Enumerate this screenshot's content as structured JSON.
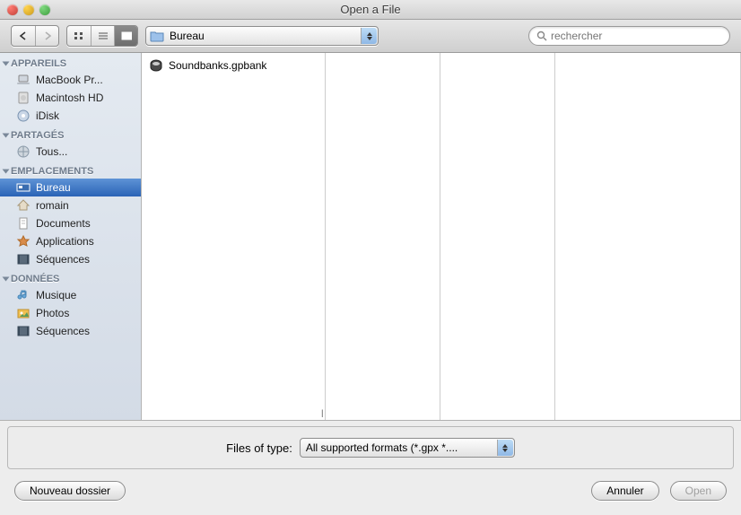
{
  "window": {
    "title": "Open a File"
  },
  "toolbar": {
    "path_label": "Bureau",
    "search_placeholder": "rechercher"
  },
  "sidebar": {
    "sections": [
      {
        "title": "APPAREILS",
        "items": [
          {
            "label": "MacBook Pr...",
            "icon": "laptop"
          },
          {
            "label": "Macintosh HD",
            "icon": "hdd"
          },
          {
            "label": "iDisk",
            "icon": "idisk"
          }
        ]
      },
      {
        "title": "PARTAGÉS",
        "items": [
          {
            "label": "Tous...",
            "icon": "globe"
          }
        ]
      },
      {
        "title": "EMPLACEMENTS",
        "items": [
          {
            "label": "Bureau",
            "icon": "desktop",
            "selected": true
          },
          {
            "label": "romain",
            "icon": "home"
          },
          {
            "label": "Documents",
            "icon": "docs"
          },
          {
            "label": "Applications",
            "icon": "apps"
          },
          {
            "label": "Séquences",
            "icon": "movies"
          }
        ]
      },
      {
        "title": "DONNÉES",
        "items": [
          {
            "label": "Musique",
            "icon": "music"
          },
          {
            "label": "Photos",
            "icon": "photos"
          },
          {
            "label": "Séquences",
            "icon": "movies"
          }
        ]
      }
    ]
  },
  "files": [
    {
      "name": "Soundbanks.gpbank"
    }
  ],
  "filter": {
    "label": "Files of type:",
    "value": "All supported formats (*.gpx *...."
  },
  "buttons": {
    "new_folder": "Nouveau dossier",
    "cancel": "Annuler",
    "open": "Open"
  }
}
